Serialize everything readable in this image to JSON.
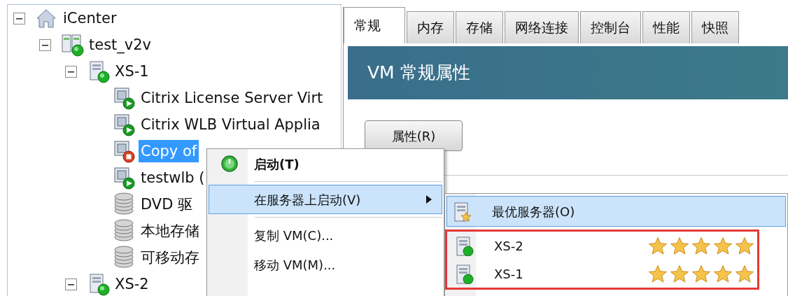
{
  "tree": [
    {
      "label": "iCenter",
      "kind": "root",
      "expanded": true,
      "selected": false,
      "children": [
        {
          "label": "test_v2v",
          "kind": "pool",
          "expanded": true,
          "selected": false,
          "children": [
            {
              "label": "XS-1",
              "kind": "host",
              "expanded": true,
              "selected": false,
              "children": [
                {
                  "label": "Citrix License Server Virt",
                  "kind": "vm",
                  "running": true,
                  "selected": false
                },
                {
                  "label": "Citrix WLB Virtual Applia",
                  "kind": "vm",
                  "running": true,
                  "selected": false
                },
                {
                  "label": "Copy of",
                  "kind": "vm",
                  "running": false,
                  "selected": true
                },
                {
                  "label": "testwlb (",
                  "kind": "vm",
                  "running": true,
                  "selected": false
                },
                {
                  "label": "DVD 驱",
                  "kind": "storage",
                  "selected": false
                },
                {
                  "label": "本地存储",
                  "kind": "storage",
                  "selected": false
                },
                {
                  "label": "可移动存",
                  "kind": "storage",
                  "selected": false
                }
              ]
            },
            {
              "label": "XS-2",
              "kind": "host",
              "expanded": true,
              "selected": false
            }
          ]
        }
      ]
    }
  ],
  "tabs": [
    {
      "label": "常规",
      "selected": true
    },
    {
      "label": "内存",
      "selected": false
    },
    {
      "label": "存储",
      "selected": false
    },
    {
      "label": "网络连接",
      "selected": false
    },
    {
      "label": "控制台",
      "selected": false
    },
    {
      "label": "性能",
      "selected": false
    },
    {
      "label": "快照",
      "selected": false
    }
  ],
  "panel": {
    "title": "VM 常规属性",
    "button": "属性(R)"
  },
  "context_menu": {
    "items": [
      {
        "kind": "action",
        "label": "启动(T)",
        "default": true,
        "selected": false
      },
      {
        "kind": "separator"
      },
      {
        "kind": "submenu",
        "label": "在服务器上启动(V)",
        "default": false,
        "selected": true
      },
      {
        "kind": "separator"
      },
      {
        "kind": "action",
        "label": "复制 VM(C)...",
        "default": false,
        "selected": false
      },
      {
        "kind": "action",
        "label": "移动 VM(M)...",
        "default": false,
        "selected": false
      }
    ]
  },
  "submenu": {
    "framed": true,
    "items": [
      {
        "kind": "best",
        "label": "最优服务器(O)",
        "selected": true
      },
      {
        "kind": "server",
        "label": "XS-2",
        "stars": 5,
        "selected": false
      },
      {
        "kind": "server",
        "label": "XS-1",
        "stars": 5,
        "selected": false
      }
    ]
  }
}
